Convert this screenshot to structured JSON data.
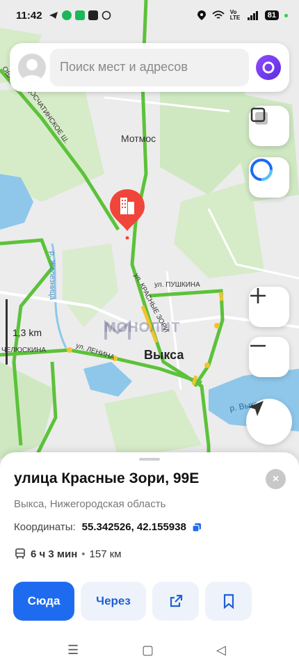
{
  "status_bar": {
    "time": "11:42",
    "battery": "81",
    "volte": "Vo LTE"
  },
  "search": {
    "placeholder": "Поиск мест и адресов"
  },
  "map": {
    "labels": {
      "motmos": "Мотмос",
      "town": "Выкса",
      "street_krasnye_zori": "ул. КРАСНЫЕ ЗОРИ",
      "street_pushkina": "ул. ПУШКИНА",
      "street_lenina": "ул. ЛЕНИНА",
      "street_chelyuskina": "ЧЕЛЮСКИНА",
      "road_doschatinskoe": "ДОСЧАТИНСКОЕ Ш.",
      "river_zheleznitsa": "р. Железница",
      "river_vyksunka": "р. Выксу",
      "edge_label": "ОВА"
    },
    "scale_label": "1,3 km",
    "watermark": "МОНОЛИТ",
    "colors": {
      "traffic_green": "#5cc23a",
      "water": "#8ec7ea",
      "park": "#cfe8c2",
      "pin": "#f0453a"
    }
  },
  "place": {
    "title": "улица Красные Зори, 99Е",
    "subtitle": "Выкса, Нижегородская область",
    "coords_label": "Координаты:",
    "coords_value": "55.342526, 42.155938",
    "transit_time": "6 ч 3 мин",
    "transit_dot": "•",
    "distance": "157 км"
  },
  "actions": {
    "here": "Сюда",
    "via": "Через"
  },
  "icons": {
    "close": "×",
    "nav_menu": "☰",
    "nav_home": "▢",
    "nav_back": "◁"
  }
}
